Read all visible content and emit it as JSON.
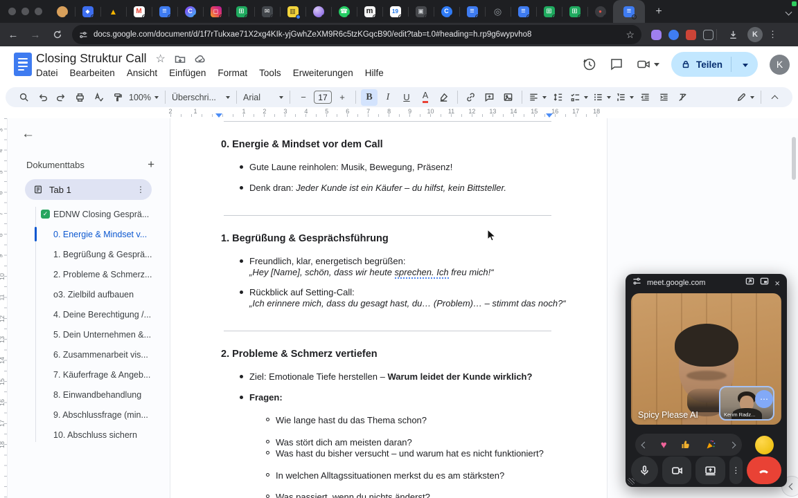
{
  "browser": {
    "tabs": [
      {
        "name": "tab-compass",
        "bg": "#d9a05b",
        "fg": "#8a5a20",
        "glyph": "",
        "fs": "9px",
        "cls": "circle"
      },
      {
        "name": "tab-blue-app",
        "bg": "#3d6ef0",
        "fg": "#ffffff",
        "glyph": "◆",
        "fs": "8px",
        "cls": ""
      },
      {
        "name": "tab-drive",
        "bg": "transparent",
        "fg": "#f4b400",
        "glyph": "▲",
        "fs": "12px",
        "cls": ""
      },
      {
        "name": "tab-gmail",
        "bg": "#ffffff",
        "fg": "#ea4335",
        "glyph": "M",
        "fs": "10px",
        "cls": "bold"
      },
      {
        "name": "tab-docs",
        "bg": "#3e7bf0",
        "fg": "#ffffff",
        "glyph": "≡",
        "fs": "11px",
        "cls": ""
      },
      {
        "name": "tab-c-gradient",
        "bg": "linear-gradient(135deg,#8a3ff5,#3fb6f5)",
        "fg": "#ffffff",
        "glyph": "C",
        "fs": "9px",
        "cls": "circle bold"
      },
      {
        "name": "tab-instagram",
        "bg": "linear-gradient(45deg,#f5a623,#e4405f,#b5179e)",
        "fg": "#ffffff",
        "glyph": "◻",
        "fs": "9px",
        "cls": ""
      },
      {
        "name": "tab-sheets",
        "bg": "#1faa5f",
        "fg": "#ffffff",
        "glyph": "⊞",
        "fs": "10px",
        "cls": ""
      },
      {
        "name": "tab-mail-dark",
        "bg": "#42464b",
        "fg": "#ffffff",
        "glyph": "✉",
        "fs": "9px",
        "cls": ""
      },
      {
        "name": "tab-yellow-app",
        "bg": "#f2d43c",
        "fg": "#433a1e",
        "glyph": "▥",
        "fs": "9px",
        "cls": "",
        "dot": "#4285f4"
      },
      {
        "name": "tab-sphere",
        "bg": "radial-gradient(circle at 35% 30%,#d9c7f5,#7a55e0)",
        "fg": "#ffffff",
        "glyph": "",
        "fs": "9px",
        "cls": "circle"
      },
      {
        "name": "tab-whatsapp",
        "bg": "#24cc63",
        "fg": "#ffffff",
        "glyph": "☎",
        "fs": "9px",
        "cls": "circle"
      },
      {
        "name": "tab-m-light",
        "bg": "#f5f5f5",
        "fg": "#222222",
        "glyph": "m",
        "fs": "11px",
        "cls": "bold"
      },
      {
        "name": "tab-calendar",
        "bg": "#ffffff",
        "fg": "#1a73e8",
        "glyph": "19",
        "fs": "8px",
        "cls": "bold"
      },
      {
        "name": "tab-cast",
        "bg": "#46484c",
        "fg": "#cfd2d6",
        "glyph": "▣",
        "fs": "9px",
        "cls": ""
      },
      {
        "name": "tab-c-blue",
        "bg": "#2f7bf6",
        "fg": "#ffffff",
        "glyph": "C",
        "fs": "9px",
        "cls": "circle bold"
      },
      {
        "name": "tab-docs-2",
        "bg": "#3e7bf0",
        "fg": "#ffffff",
        "glyph": "≡",
        "fs": "11px",
        "cls": ""
      },
      {
        "name": "tab-ring",
        "bg": "transparent",
        "fg": "#9aa0a6",
        "glyph": "◎",
        "fs": "13px",
        "cls": "circle"
      },
      {
        "name": "tab-docs-3",
        "bg": "#3e7bf0",
        "fg": "#ffffff",
        "glyph": "≡",
        "fs": "11px",
        "cls": ""
      },
      {
        "name": "tab-sheets-2",
        "bg": "#1faa5f",
        "fg": "#ffffff",
        "glyph": "⊞",
        "fs": "10px",
        "cls": ""
      },
      {
        "name": "tab-sheets-3",
        "bg": "#1faa5f",
        "fg": "#ffffff",
        "glyph": "⊞",
        "fs": "10px",
        "cls": ""
      },
      {
        "name": "tab-record",
        "bg": "#3a3b3f",
        "fg": "#e5544b",
        "glyph": "●",
        "fs": "8px",
        "cls": "circle"
      },
      {
        "name": "tab-docs-active",
        "bg": "#3e7bf0",
        "fg": "#ffffff",
        "glyph": "≡",
        "fs": "11px",
        "cls": "",
        "active": "active"
      }
    ],
    "new_tab_label": "+",
    "url": "docs.google.com/document/d/1f7rTukxae71X2xg4KIk-yjGwhZeXM9R6c5tzKGqcB90/edit?tab=t.0#heading=h.rp9g6wypvho8",
    "extensions": [
      {
        "name": "extension-purple",
        "bg": "#9f7ff0",
        "radius": "5px"
      },
      {
        "name": "extension-blue",
        "bg": "#3f7df2",
        "radius": "50%"
      },
      {
        "name": "extension-red",
        "bg": "#cc4437",
        "radius": "4px"
      },
      {
        "name": "extension-outline",
        "bg": "transparent",
        "radius": "4px",
        "border": "1.5px solid #9aa0a6"
      }
    ],
    "avatar_letter": "K"
  },
  "docs": {
    "title": "Closing Struktur Call",
    "menus": [
      {
        "label": "Datei"
      },
      {
        "label": "Bearbeiten"
      },
      {
        "label": "Ansicht"
      },
      {
        "label": "Einfügen"
      },
      {
        "label": "Format"
      },
      {
        "label": "Tools"
      },
      {
        "label": "Erweiterungen"
      },
      {
        "label": "Hilfe"
      }
    ],
    "share_label": "Teilen",
    "avatar_letter": "K",
    "toolbar": {
      "zoom": "100%",
      "style": "Überschri...",
      "font": "Arial",
      "font_size": "17",
      "minus": "−",
      "plus": "+",
      "bold": "B",
      "italic": "I",
      "underline": "U",
      "color_letter": "A"
    }
  },
  "ruler": {
    "h_numbers": [
      "2",
      "1",
      "1",
      "2",
      "3",
      "4",
      "5",
      "6",
      "7",
      "8",
      "9",
      "10",
      "11",
      "12",
      "13",
      "14",
      "15",
      "16",
      "17",
      "18"
    ],
    "v_numbers": [
      "3",
      "4",
      "5",
      "6",
      "7",
      "8",
      "9",
      "10",
      "11",
      "12",
      "13",
      "14",
      "15",
      "16",
      "17",
      "18"
    ]
  },
  "sidebar": {
    "header": "Dokumenttabs",
    "add_label": "+",
    "tab_label": "Tab 1",
    "items": [
      {
        "label": "EDNW Closing Gesprä...",
        "state": "",
        "icon": "check"
      },
      {
        "label": "0. Energie & Mindset v...",
        "state": "active",
        "icon": ""
      },
      {
        "label": "1. Begrüßung & Gesprä...",
        "state": "",
        "icon": ""
      },
      {
        "label": "2. Probleme & Schmerz...",
        "state": "",
        "icon": ""
      },
      {
        "label": "o3. Zielbild aufbauen",
        "state": "",
        "icon": ""
      },
      {
        "label": "4. Deine Berechtigung /...",
        "state": "",
        "icon": ""
      },
      {
        "label": "5. Dein Unternehmen &...",
        "state": "",
        "icon": ""
      },
      {
        "label": "6. Zusammenarbeit vis...",
        "state": "",
        "icon": ""
      },
      {
        "label": "7. Käuferfrage & Angeb...",
        "state": "",
        "icon": ""
      },
      {
        "label": "8. Einwandbehandlung",
        "state": "",
        "icon": ""
      },
      {
        "label": "9. Abschlussfrage (min...",
        "state": "",
        "icon": ""
      },
      {
        "label": "10. Abschluss sichern",
        "state": "",
        "icon": ""
      }
    ]
  },
  "document": {
    "blocks": [
      {
        "type": "divider",
        "cls": "first"
      },
      {
        "type": "h",
        "lines": [
          [
            {
              "t": "0. Energie & Mindset vor dem Call"
            }
          ]
        ]
      },
      {
        "type": "bullet",
        "lines": [
          [
            {
              "t": "Gute Laune reinholen: Musik, Bewegung, Präsenz!"
            }
          ]
        ]
      },
      {
        "type": "bullet",
        "cls": "second",
        "lines": [
          [
            {
              "t": "Denk dran: "
            },
            {
              "t": "Jeder Kunde ist ein Käufer – du hilfst, kein Bittsteller.",
              "s": "i"
            }
          ]
        ]
      },
      {
        "type": "divider",
        "cls": "gap"
      },
      {
        "type": "h",
        "lines": [
          [
            {
              "t": "1. Begrüßung & Gesprächsführung"
            }
          ]
        ]
      },
      {
        "type": "bullet",
        "lines": [
          [
            {
              "t": "Freundlich, klar, energetisch begrüßen:"
            }
          ],
          [
            {
              "t": "„Hey [Name], schön, dass wir heute ",
              "s": "i"
            },
            {
              "t": "sprechen. Ich",
              "s": "i ublue"
            },
            {
              "t": " freu mich!“",
              "s": "i"
            }
          ]
        ]
      },
      {
        "type": "bullet",
        "cls": "second",
        "lines": [
          [
            {
              "t": "Rückblick auf Setting-Call:"
            }
          ],
          [
            {
              "t": "„Ich erinnere mich, dass du gesagt hast, du… (Problem)… – stimmt das noch?“",
              "s": "i"
            }
          ]
        ]
      },
      {
        "type": "divider",
        "cls": "gap"
      },
      {
        "type": "h",
        "lines": [
          [
            {
              "t": "2. Probleme & Schmerz vertiefen"
            }
          ]
        ]
      },
      {
        "type": "bullet",
        "lines": [
          [
            {
              "t": "Ziel: Emotionale Tiefe herstellen – "
            },
            {
              "t": "Warum leidet der Kunde wirklich?",
              "s": "b"
            }
          ]
        ]
      },
      {
        "type": "bullet",
        "cls": "second",
        "lines": [
          [
            {
              "t": "Fragen:",
              "s": "b"
            }
          ]
        ]
      },
      {
        "type": "sub",
        "cls": "first",
        "lines": [
          [
            {
              "t": "Wie lange hast du das Thema schon?"
            }
          ]
        ]
      },
      {
        "type": "sub",
        "lines": [
          [
            {
              "t": "Was stört dich am meisten daran?"
            }
          ]
        ]
      },
      {
        "type": "sub",
        "cls": "tight",
        "lines": [
          [
            {
              "t": "Was hast du bisher versucht – und warum hat es nicht funktioniert?"
            }
          ]
        ]
      },
      {
        "type": "sub",
        "lines": [
          [
            {
              "t": "In welchen Alltagssituationen merkst du es am stärksten?"
            }
          ]
        ]
      },
      {
        "type": "sub",
        "lines": [
          [
            {
              "t": "Was passiert, wenn du nichts änderst?"
            }
          ]
        ]
      }
    ]
  },
  "meet": {
    "title": "meet.google.com",
    "main_label": "Spicy Please AI",
    "self_label": "Kerim Radz...",
    "more_glyph": "⋯"
  },
  "colors": {
    "accent_blue": "#0b57d0",
    "share_bg": "#c2e7ff",
    "hangup_red": "#e94235",
    "sheets_green": "#1faa5f",
    "docs_blue": "#3e7bf0"
  }
}
